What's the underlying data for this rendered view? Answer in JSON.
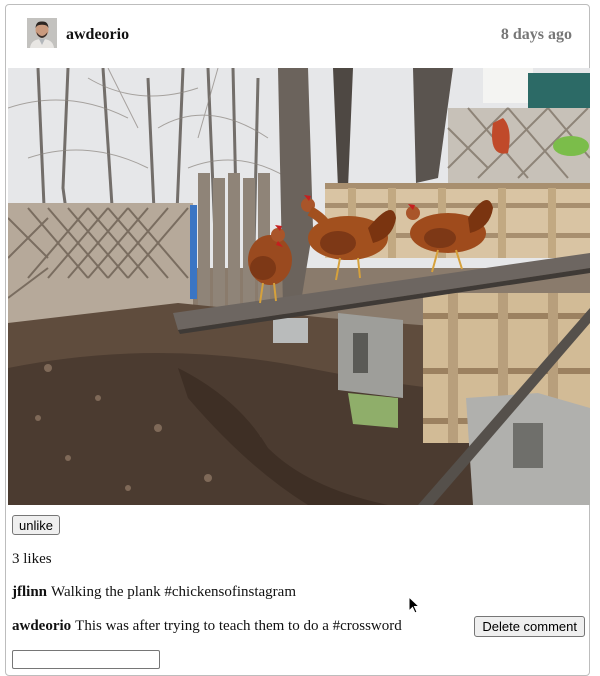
{
  "post": {
    "owner": "awdeorio",
    "timestamp": "8 days ago",
    "owner_avatar_icon": "user-avatar-icon",
    "image_icon": "chickens-photo",
    "like_button_label": "unlike",
    "likes_text": "3 likes",
    "comments": [
      {
        "owner": "jflinn",
        "text": "Walking the plank #chickensofinstagram"
      },
      {
        "owner": "awdeorio",
        "text": "This was after trying to teach them to do a #crossword",
        "delete_label": "Delete comment"
      }
    ],
    "comment_input": {
      "value": "",
      "placeholder": ""
    }
  },
  "colors": {
    "border": "#bdbdbd",
    "timestamp": "#777777",
    "button_bg": "#efefef"
  }
}
